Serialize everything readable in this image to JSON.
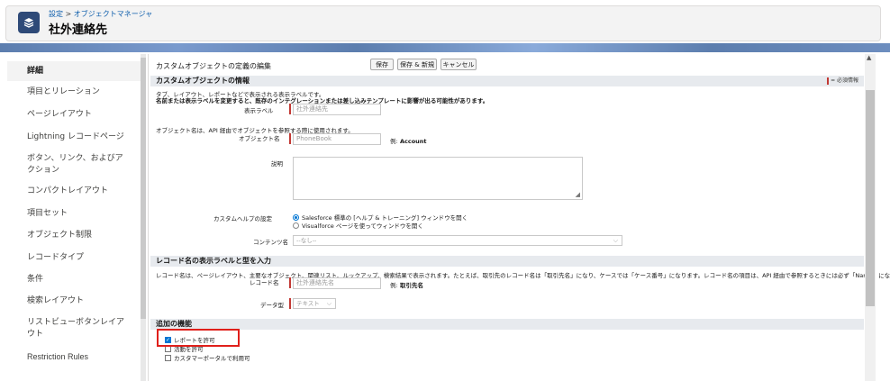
{
  "header": {
    "breadcrumb_setup": "設定",
    "breadcrumb_sep": " > ",
    "breadcrumb_object_manager": "オブジェクトマネージャ",
    "title": "社外連絡先",
    "icon": "layers-icon"
  },
  "sidebar": {
    "items": [
      {
        "label": "詳細",
        "active": true
      },
      {
        "label": "項目とリレーション"
      },
      {
        "label": "ページレイアウト"
      },
      {
        "label": "Lightning レコードページ"
      },
      {
        "label": "ボタン、リンク、およびア"
      },
      {
        "label": "クション"
      },
      {
        "label": "コンパクトレイアウト"
      },
      {
        "label": "項目セット"
      },
      {
        "label": "オブジェクト制限"
      },
      {
        "label": "レコードタイプ"
      },
      {
        "label": "条件"
      },
      {
        "label": "検索レイアウト"
      },
      {
        "label": "リストビューボタンレイア"
      },
      {
        "label": "ウト"
      },
      {
        "label": "Restriction Rules"
      }
    ]
  },
  "edit": {
    "title": "カスタムオブジェクトの定義の編集",
    "buttons": {
      "save": "保存",
      "save_new": "保存 & 新規",
      "cancel": "キャンセル"
    }
  },
  "section_info": {
    "title": "カスタムオブジェクトの情報",
    "required_legend": "= 必須情報",
    "note1": "タブ、レイアウト、レポートなどで表示される表示ラベルです。",
    "note2": "名前または表示ラベルを変更すると、既存のインテグレーションまたは差し込みテンプレートに影響が出る可能性があります。",
    "label_field": {
      "label": "表示ラベル",
      "value": "社外連絡先"
    },
    "note3": "オブジェクト名は、API 経由でオブジェクトを参照する際に使用されます。",
    "object_name": {
      "label": "オブジェクト名",
      "value": "PhoneBook",
      "example_prefix": "例:",
      "example_value": "Account"
    },
    "description": {
      "label": "説明"
    },
    "help_setting": {
      "label": "カスタムヘルプの設定",
      "option1": "Salesforce 標準の [ヘルプ & トレーニング] ウィンドウを開く",
      "option2": "Visualforce ページを使ってウィンドウを開く",
      "selected": "option1"
    },
    "content_name": {
      "label": "コンテンツ名",
      "value": "--なし--"
    }
  },
  "section_record": {
    "title": "レコード名の表示ラベルと型を入力",
    "note": "レコード名は、ページレイアウト、主要なオブジェクト、関連リスト、ルックアップ、検索結果で表示されます。たとえば、取引先のレコード名は「取引先名」になり、ケースでは「ケース番号」になります。レコード名の項目は、API 経由で参照するときには必ず「Name」になります。",
    "record_name": {
      "label": "レコード名",
      "value": "社外連絡先名",
      "example_prefix": "例:",
      "example_value": "取引先名"
    },
    "data_type": {
      "label": "データ型",
      "value": "テキスト"
    }
  },
  "section_features": {
    "title": "追加の機能",
    "allow_reports": {
      "label": "レポートを許可",
      "checked": true
    },
    "activities": {
      "label": "活動を許可",
      "checked": false
    },
    "customer_portal": {
      "label": "カスタマーポータルで利用可",
      "checked": false
    }
  }
}
